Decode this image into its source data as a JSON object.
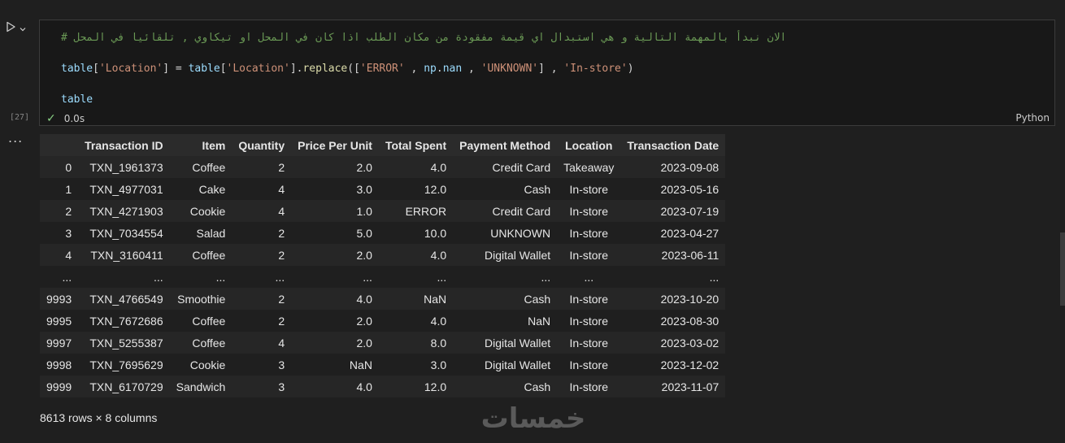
{
  "cell": {
    "exec_count": "[27]",
    "code_lines": [
      {
        "parts": [
          {
            "t": "# الان نبدأ بالمهمة التالية و هي استبدال اي قيمة مفقودة من مكان الطلب اذا كان في المحل او تيكاوي , تلقائيا في المحل",
            "c": "c-comment"
          }
        ]
      },
      {
        "parts": []
      },
      {
        "parts": [
          {
            "t": "table",
            "c": "c-var"
          },
          {
            "t": "[",
            "c": "c-punc"
          },
          {
            "t": "'Location'",
            "c": "c-str"
          },
          {
            "t": "] = ",
            "c": "c-punc"
          },
          {
            "t": "table",
            "c": "c-var"
          },
          {
            "t": "[",
            "c": "c-punc"
          },
          {
            "t": "'Location'",
            "c": "c-str"
          },
          {
            "t": "].",
            "c": "c-punc"
          },
          {
            "t": "replace",
            "c": "c-fn"
          },
          {
            "t": "([",
            "c": "c-punc"
          },
          {
            "t": "'ERROR'",
            "c": "c-str"
          },
          {
            "t": " , ",
            "c": "c-punc"
          },
          {
            "t": "np",
            "c": "c-var"
          },
          {
            "t": ".",
            "c": "c-punc"
          },
          {
            "t": "nan",
            "c": "c-var"
          },
          {
            "t": " , ",
            "c": "c-punc"
          },
          {
            "t": "'UNKNOWN'",
            "c": "c-str"
          },
          {
            "t": "] , ",
            "c": "c-punc"
          },
          {
            "t": "'In-store'",
            "c": "c-str"
          },
          {
            "t": ")",
            "c": "c-punc"
          }
        ]
      },
      {
        "parts": []
      },
      {
        "parts": [
          {
            "t": "table",
            "c": "c-var"
          }
        ]
      }
    ],
    "status_time": "0.0s",
    "language": "Python"
  },
  "output": {
    "dots": "...",
    "columns": [
      "",
      "Transaction ID",
      "Item",
      "Quantity",
      "Price Per Unit",
      "Total Spent",
      "Payment Method",
      "Location",
      "Transaction Date"
    ],
    "rows": [
      [
        "0",
        "TXN_1961373",
        "Coffee",
        "2",
        "2.0",
        "4.0",
        "Credit Card",
        "Takeaway",
        "2023-09-08"
      ],
      [
        "1",
        "TXN_4977031",
        "Cake",
        "4",
        "3.0",
        "12.0",
        "Cash",
        "In-store",
        "2023-05-16"
      ],
      [
        "2",
        "TXN_4271903",
        "Cookie",
        "4",
        "1.0",
        "ERROR",
        "Credit Card",
        "In-store",
        "2023-07-19"
      ],
      [
        "3",
        "TXN_7034554",
        "Salad",
        "2",
        "5.0",
        "10.0",
        "UNKNOWN",
        "In-store",
        "2023-04-27"
      ],
      [
        "4",
        "TXN_3160411",
        "Coffee",
        "2",
        "2.0",
        "4.0",
        "Digital Wallet",
        "In-store",
        "2023-06-11"
      ],
      [
        "...",
        "...",
        "...",
        "...",
        "...",
        "...",
        "...",
        "...",
        "..."
      ],
      [
        "9993",
        "TXN_4766549",
        "Smoothie",
        "2",
        "4.0",
        "NaN",
        "Cash",
        "In-store",
        "2023-10-20"
      ],
      [
        "9995",
        "TXN_7672686",
        "Coffee",
        "2",
        "2.0",
        "4.0",
        "NaN",
        "In-store",
        "2023-08-30"
      ],
      [
        "9997",
        "TXN_5255387",
        "Coffee",
        "4",
        "2.0",
        "8.0",
        "Digital Wallet",
        "In-store",
        "2023-03-02"
      ],
      [
        "9998",
        "TXN_7695629",
        "Cookie",
        "3",
        "NaN",
        "3.0",
        "Digital Wallet",
        "In-store",
        "2023-12-02"
      ],
      [
        "9999",
        "TXN_6170729",
        "Sandwich",
        "3",
        "4.0",
        "12.0",
        "Cash",
        "In-store",
        "2023-11-07"
      ]
    ],
    "shape_text": "8613 rows × 8 columns"
  },
  "watermark_text": "خمسات",
  "icons": {
    "run": "play-icon",
    "chevron": "chevron-down-icon",
    "status": "check-icon",
    "more": "more-icon"
  }
}
